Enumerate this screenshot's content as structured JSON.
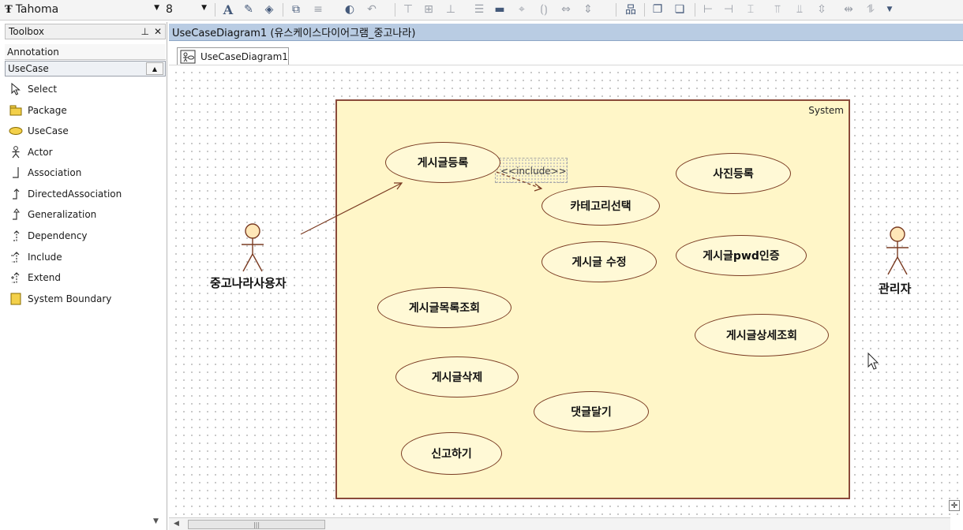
{
  "toolbar": {
    "font_name": "Tahoma",
    "font_size": "8"
  },
  "toolbox": {
    "title": "Toolbox",
    "categories": [
      "Annotation",
      "UseCase"
    ],
    "items": [
      {
        "label": "Select",
        "icon": "cursor-icon"
      },
      {
        "label": "Package",
        "icon": "package-icon"
      },
      {
        "label": "UseCase",
        "icon": "usecase-icon"
      },
      {
        "label": "Actor",
        "icon": "actor-icon"
      },
      {
        "label": "Association",
        "icon": "association-icon"
      },
      {
        "label": "DirectedAssociation",
        "icon": "directed-association-icon"
      },
      {
        "label": "Generalization",
        "icon": "generalization-icon"
      },
      {
        "label": "Dependency",
        "icon": "dependency-icon"
      },
      {
        "label": "Include",
        "icon": "include-icon"
      },
      {
        "label": "Extend",
        "icon": "extend-icon"
      },
      {
        "label": "System Boundary",
        "icon": "system-boundary-icon"
      }
    ]
  },
  "document": {
    "title": "UseCaseDiagram1 (유스케이스다이어그램_중고나라)",
    "tab_label": "UseCaseDiagram1"
  },
  "diagram": {
    "system_label": "System",
    "include_label": "<<include>>",
    "actors": [
      "중고나라사용자",
      "관리자"
    ],
    "usecases": [
      "게시글등록",
      "카테고리선택",
      "사진등록",
      "게시글 수정",
      "게시글pwd인증",
      "게시글목록조회",
      "게시글상세조회",
      "게시글삭제",
      "댓글달기",
      "신고하기"
    ]
  },
  "colors": {
    "system_fill": "#fff6c8",
    "system_border": "#8a4a3a",
    "title_bar": "#b9cce3",
    "actor_head": "#ffe7b8"
  }
}
